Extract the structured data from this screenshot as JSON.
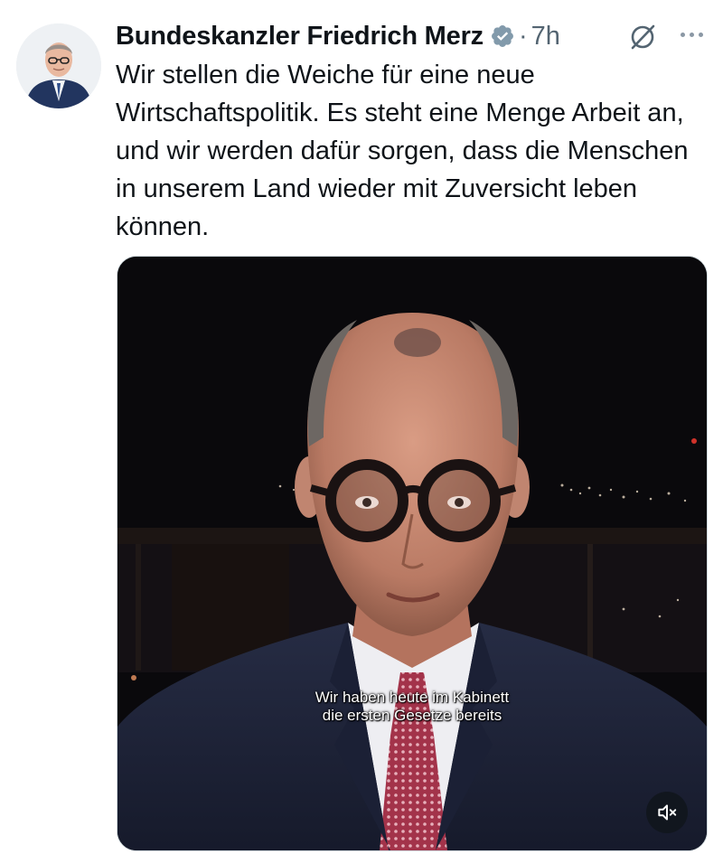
{
  "post": {
    "author_name": "Bundeskanzler Friedrich Merz",
    "separator": "·",
    "time": "7h",
    "text": "Wir stellen die Weiche für eine neue Wirtschaftspolitik. Es steht eine Menge Arbeit an, und wir werden dafür sorgen, dass die Menschen in unserem Land wieder mit Zuversicht leben können."
  },
  "video": {
    "subtitle_line_1": "Wir haben heute im Kabinett",
    "subtitle_line_2": "die ersten Gesetze bereits"
  },
  "icons": {
    "verified": "verified-badge-icon",
    "grok": "grok-icon",
    "more": "more-options-icon",
    "mute": "muted-speaker-icon"
  },
  "colors": {
    "text": "#0f1419",
    "secondary": "#536471",
    "verified_badge": "#829aab"
  }
}
